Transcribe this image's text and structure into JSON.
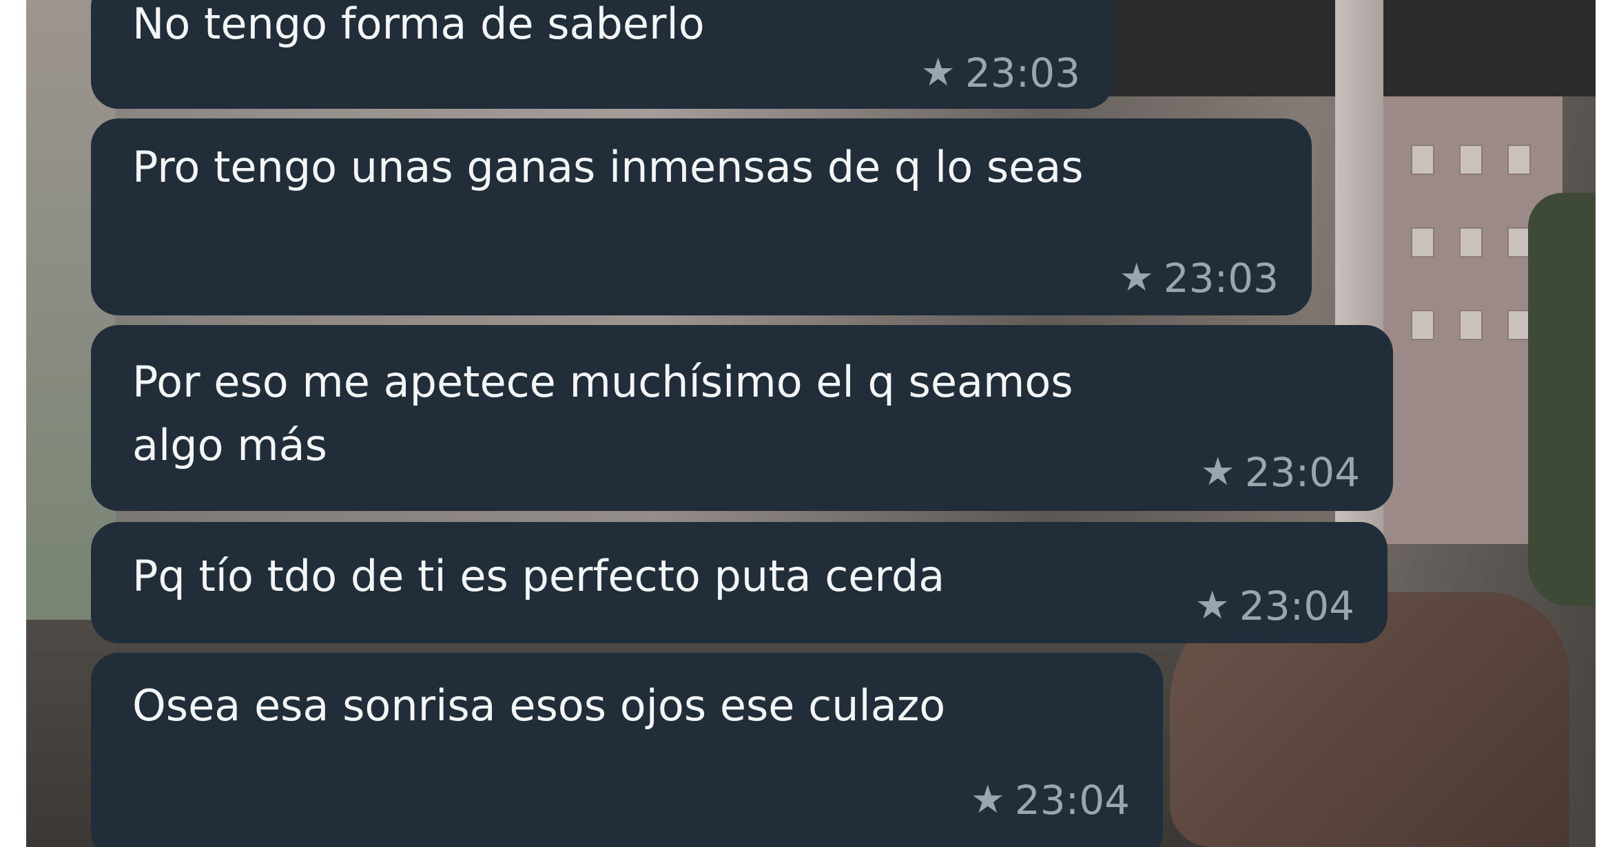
{
  "messages": [
    {
      "text": "No tengo forma de saberlo",
      "starred": true,
      "time": "23:03"
    },
    {
      "text": "Pro tengo unas ganas inmensas de q lo seas",
      "starred": true,
      "time": "23:03"
    },
    {
      "text_line1": "Por eso me apetece muchísimo el q seamos",
      "text_line2": "algo más",
      "starred": true,
      "time": "23:04"
    },
    {
      "text": "Pq tío tdo de ti es perfecto puta cerda",
      "starred": true,
      "time": "23:04"
    },
    {
      "text": "Osea esa sonrisa esos ojos ese culazo",
      "starred": true,
      "time": "23:04"
    }
  ],
  "icons": {
    "star": "star-icon"
  },
  "colors": {
    "bubble": "#212d38",
    "message_text": "#f3f5f6",
    "meta_text": "#9aa5ae",
    "page_background": "#ffffff"
  }
}
